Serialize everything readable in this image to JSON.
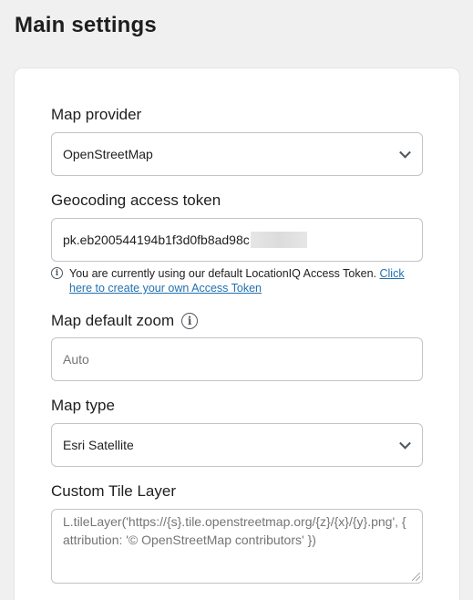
{
  "page": {
    "title": "Main settings"
  },
  "fields": {
    "map_provider": {
      "label": "Map provider",
      "value": "OpenStreetMap"
    },
    "geocoding_token": {
      "label": "Geocoding access token",
      "value": "pk.eb200544194b1f3d0fb8ad98c",
      "notice_text": "You are currently using our default LocationIQ Access Token.",
      "notice_link": "Click here to create your own Access Token"
    },
    "map_default_zoom": {
      "label": "Map default zoom",
      "placeholder": "Auto"
    },
    "map_type": {
      "label": "Map type",
      "value": "Esri Satellite"
    },
    "custom_tile_layer": {
      "label": "Custom Tile Layer",
      "placeholder": "L.tileLayer('https://{s}.tile.openstreetmap.org/{z}/{x}/{y}.png', { attribution: '© OpenStreetMap contributors' })"
    }
  },
  "icons": {
    "info": "info-icon",
    "chevron": "chevron-down-icon"
  },
  "colors": {
    "background": "#f0f0f1",
    "card": "#ffffff",
    "border": "#c3c4c7",
    "link": "#2271b1"
  }
}
